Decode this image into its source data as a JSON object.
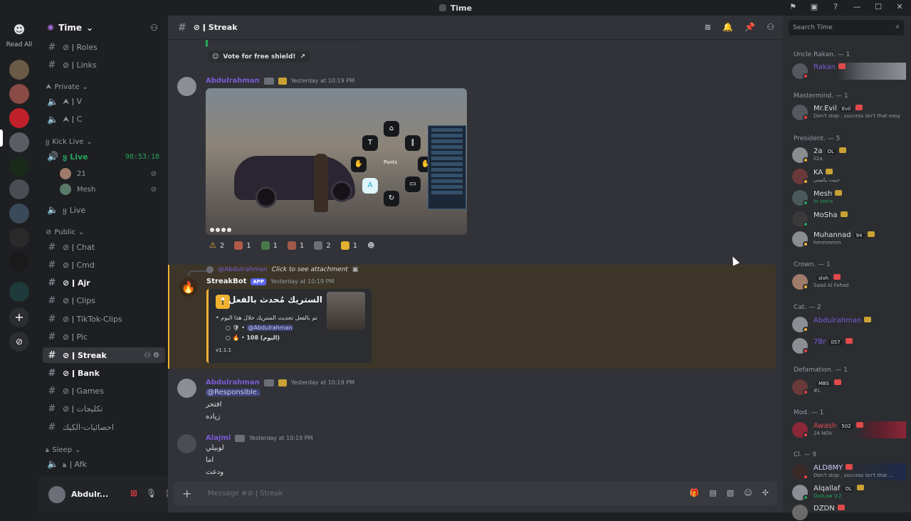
{
  "window": {
    "title": "Time"
  },
  "servers": {
    "read_all": "Read All"
  },
  "guild": {
    "name": "Time"
  },
  "channels": [
    {
      "name": "⊘ ǀ Roles",
      "type": "text"
    },
    {
      "name": "⊘ ǀ Links",
      "type": "text"
    },
    {
      "name": "Private",
      "type": "category"
    },
    {
      "name": "⮝ ǀ V",
      "type": "voice"
    },
    {
      "name": "⮝ ǀ C",
      "type": "voice"
    },
    {
      "name": "Kick Live",
      "type": "category"
    },
    {
      "name": "Live",
      "type": "voice-live",
      "timer": "98:53:18"
    },
    {
      "name": "Live",
      "type": "voice"
    },
    {
      "name": "Public",
      "type": "category"
    },
    {
      "name": "⊘ ǀ Chat",
      "type": "text"
    },
    {
      "name": "⊘ ǀ Cmd",
      "type": "text"
    },
    {
      "name": "⊘ ǀ Ajr",
      "type": "text-bold"
    },
    {
      "name": "⊘ ǀ Clips",
      "type": "text"
    },
    {
      "name": "⊘ ǀ TikTok-Clips",
      "type": "text"
    },
    {
      "name": "⊘ ǀ Pic",
      "type": "text"
    },
    {
      "name": "⊘ ǀ Streak",
      "type": "text-selected"
    },
    {
      "name": "⊘ ǀ Bank",
      "type": "text-bold"
    },
    {
      "name": "⊘ ǀ Games",
      "type": "text"
    },
    {
      "name": "⊘ ǀ تكليجات",
      "type": "text"
    },
    {
      "name": "احصائيات-الكيك",
      "type": "text"
    },
    {
      "name": "Sleep",
      "type": "category"
    },
    {
      "name": "ǀ Afk",
      "type": "voice"
    }
  ],
  "voice_users": [
    {
      "name": "21"
    },
    {
      "name": "Mesh"
    }
  ],
  "category_prefix": {
    "kick": "ყ",
    "sleep": "ﻫ",
    "afk": "ﻫ"
  },
  "user_panel": {
    "name": "Abdulr..."
  },
  "header": {
    "channel": "⊘ ǀ Streak"
  },
  "messages": {
    "vote": "Vote for free shield!",
    "m1": {
      "author": "Abdulrahman",
      "time": "Yesterday at 10:19 PM"
    },
    "reactions": [
      {
        "emoji": "warning",
        "count": "2"
      },
      {
        "emoji": "face",
        "count": "1"
      },
      {
        "emoji": "green",
        "count": "1"
      },
      {
        "emoji": "face2",
        "count": "1"
      },
      {
        "emoji": "gray",
        "count": "2"
      },
      {
        "emoji": "cry",
        "count": "1"
      }
    ],
    "reply": {
      "author": "@Abdulrahman",
      "text": "Click to see attachment"
    },
    "bot": {
      "name": "StreakBot",
      "app": "APP",
      "time": "Yesterday at 10:19 PM"
    },
    "embed": {
      "title": "الستريك مُحدث بالفعل •",
      "line1": "تم بالفعل تحديث الستريك خلال هذا اليوم",
      "line2": "@Abdulrahman",
      "line3": "108 (اليوم)",
      "version": "v1.1.1"
    },
    "m2": {
      "author": "Abdulrahman",
      "time": "Yesterday at 10:19 PM",
      "mention": "@Responsible.",
      "l1": "افتحر",
      "l2": "زياده"
    },
    "m3": {
      "author": "Alajmi",
      "time": "Yesterday at 10:19 PM",
      "l1": "لوبيلي",
      "l2": "اما",
      "l3": "ودعت"
    },
    "screenshot": {
      "center": "Pants"
    }
  },
  "composer": {
    "placeholder": "Message #⊘ ǀ Streak"
  },
  "members": {
    "search_placeholder": "Search Time",
    "groups": [
      {
        "title": "Uncle Rakan. — 1"
      },
      {
        "title": "Mastermind. — 1"
      },
      {
        "title": "President. — 5"
      },
      {
        "title": "Crown. — 1"
      },
      {
        "title": "Cat. — 2"
      },
      {
        "title": "Defamation. — 1"
      },
      {
        "title": "Mod. — 1"
      },
      {
        "title": "Cl. — 9"
      }
    ],
    "list": [
      {
        "name": "Rakan",
        "sub": ""
      },
      {
        "name": "Mr.Evil",
        "badge": "Evil",
        "sub": "Don't stop , success isn't that easy"
      },
      {
        "name": "2a",
        "badge": "OL",
        "sub": "ii2a"
      },
      {
        "name": "KA",
        "sub": "حبيت يكفيني"
      },
      {
        "name": "Mesh",
        "sub": "In voice"
      },
      {
        "name": "MoSha",
        "sub": ""
      },
      {
        "name": "Muhannad",
        "badge": "94",
        "sub": "hmmmmm"
      },
      {
        "name": "",
        "badge": "slvh",
        "sub": "Saad Al Fahad"
      },
      {
        "name": "Abdulrahman",
        "sub": ""
      },
      {
        "name": "7Br",
        "badge": "057",
        "sub": ""
      },
      {
        "name": "",
        "badge": "MBS",
        "sub": "#L"
      },
      {
        "name": "Awash",
        "badge": "502",
        "sub": "24 NOV"
      },
      {
        "name": "ALD8MY",
        "sub": "Don't stop , success isn't that ..."
      },
      {
        "name": "Alqallaf",
        "badge": "OL",
        "sub": "OutLaw V.2"
      },
      {
        "name": "DZDN",
        "sub": ""
      }
    ]
  },
  "colors": {
    "accent": "#5865f2",
    "highlight": "#f0b232",
    "online": "#23a55a",
    "idle": "#f0b232",
    "dnd": "#f23f43"
  }
}
